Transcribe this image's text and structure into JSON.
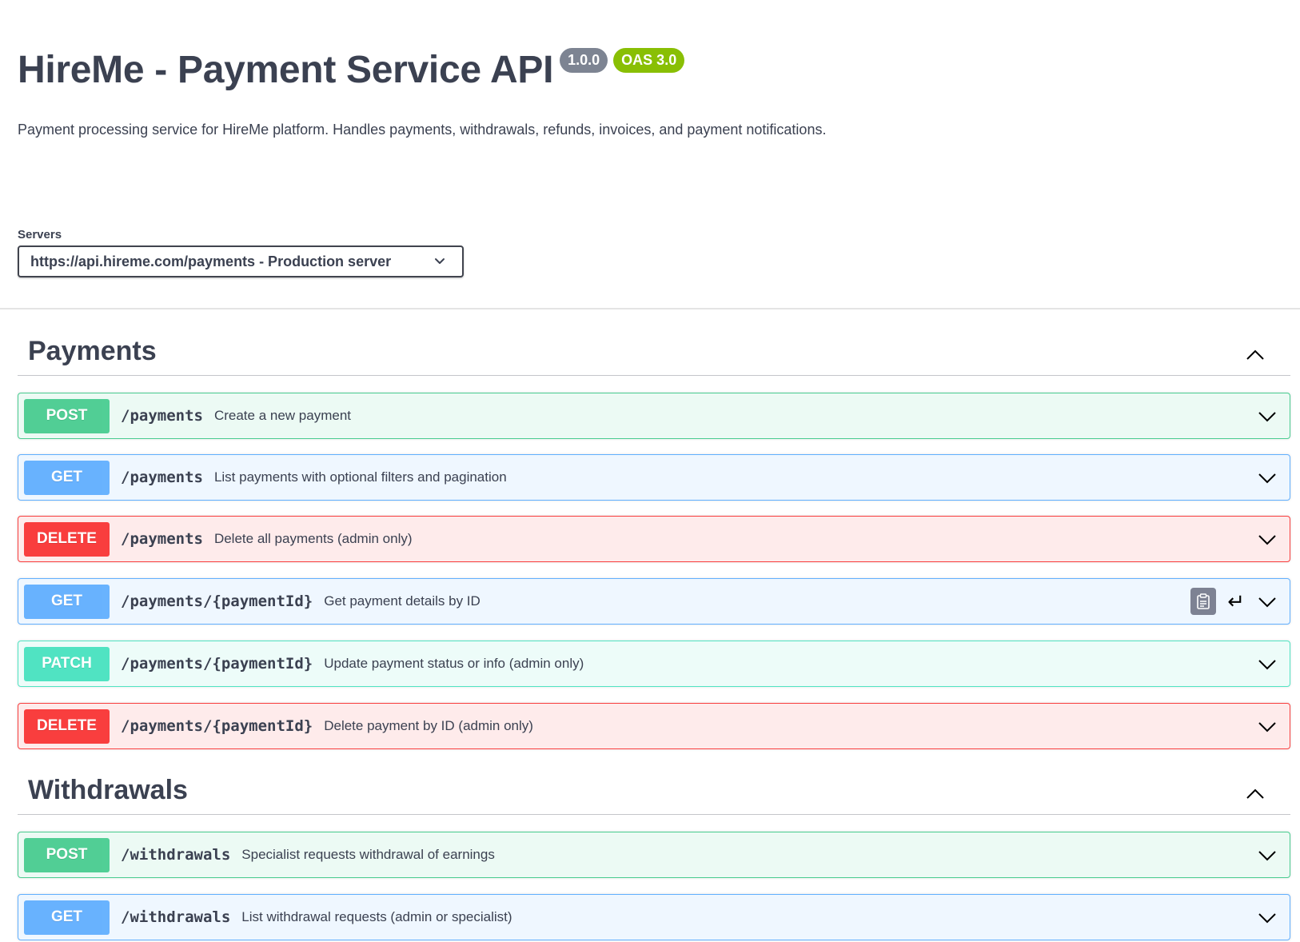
{
  "info": {
    "title": "HireMe - Payment Service API",
    "version": "1.0.0",
    "oas": "OAS 3.0",
    "description": "Payment processing service for HireMe platform. Handles payments, withdrawals, refunds, invoices, and payment notifications."
  },
  "servers": {
    "label": "Servers",
    "selected": "https://api.hireme.com/payments - Production server"
  },
  "tags": [
    {
      "name": "Payments",
      "operations": [
        {
          "method": "POST",
          "path": "/payments",
          "summary": "Create a new payment"
        },
        {
          "method": "GET",
          "path": "/payments",
          "summary": "List payments with optional filters and pagination"
        },
        {
          "method": "DELETE",
          "path": "/payments",
          "summary": "Delete all payments (admin only)"
        },
        {
          "method": "GET",
          "path": "/payments/{paymentId}",
          "summary": "Get payment details by ID"
        },
        {
          "method": "PATCH",
          "path": "/payments/{paymentId}",
          "summary": "Update payment status or info (admin only)"
        },
        {
          "method": "DELETE",
          "path": "/payments/{paymentId}",
          "summary": "Delete payment by ID (admin only)"
        }
      ]
    },
    {
      "name": "Withdrawals",
      "operations": [
        {
          "method": "POST",
          "path": "/withdrawals",
          "summary": "Specialist requests withdrawal of earnings"
        },
        {
          "method": "GET",
          "path": "/withdrawals",
          "summary": "List withdrawal requests (admin or specialist)"
        }
      ]
    }
  ],
  "colors": {
    "post": "#49cc90",
    "get": "#61affe",
    "delete": "#f93e3e",
    "patch": "#50e3c2",
    "version_badge": "#7d8492",
    "oas_badge": "#89bf04"
  },
  "icons": {
    "copy": "clipboard-icon",
    "try": "enter-arrow-icon",
    "expand": "chevron-down-icon",
    "collapse": "chevron-up-icon"
  }
}
